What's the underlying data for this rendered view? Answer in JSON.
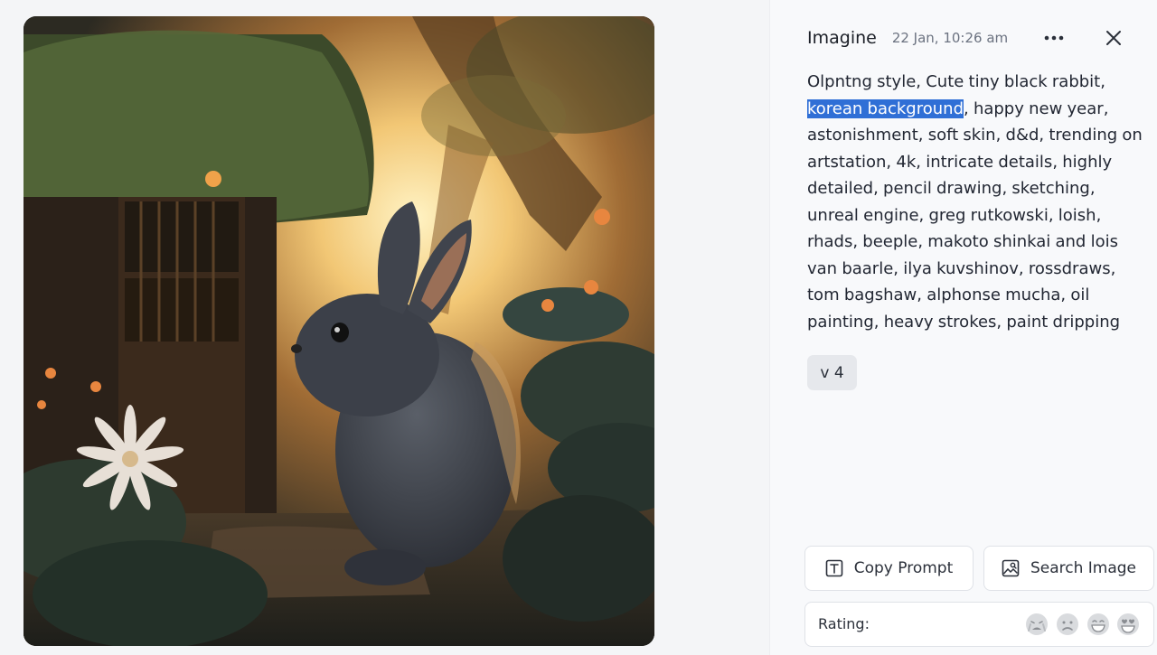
{
  "header": {
    "title": "Imagine",
    "timestamp": "22 Jan, 10:26 am"
  },
  "prompt": {
    "before": "Olpntng style, Cute tiny black rabbit, ",
    "highlighted": "korean background",
    "after": ", happy new year, astonishment, soft skin, d&d, trending on artstation, 4k, intricate details, highly detailed, pencil drawing, sketching, unreal engine, greg rutkowski, loish, rhads, beeple, makoto shinkai and lois van baarle, ilya kuvshinov, rossdraws, tom bagshaw, alphonse mucha, oil painting, heavy strokes, paint dripping"
  },
  "version_chip": "v 4",
  "actions": {
    "copy_prompt": "Copy Prompt",
    "search_image": "Search Image"
  },
  "rating": {
    "label": "Rating:",
    "options": [
      "crying-face-icon",
      "frowning-face-icon",
      "grinning-face-icon",
      "heart-eyes-face-icon"
    ]
  },
  "colors": {
    "highlight": "#2f6fd6",
    "panel_bg": "#f8f9fb",
    "chip_bg": "#e6e8ec"
  }
}
